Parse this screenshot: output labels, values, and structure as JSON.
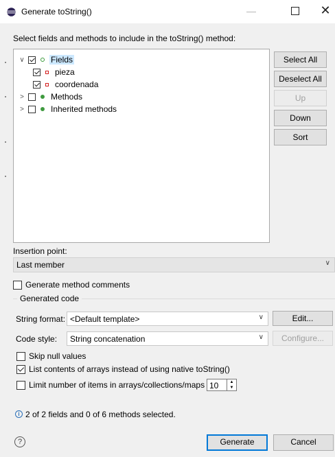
{
  "window": {
    "title": "Generate toString()",
    "minimize_glyph": "—",
    "close_glyph": "✕"
  },
  "instruction": "Select fields and methods to include in the toString() method:",
  "tree": {
    "twisty_expanded": "∨",
    "twisty_collapsed": ">",
    "items": [
      {
        "label": "Fields",
        "checked": true,
        "expanded": true,
        "icon": "field-group-hollow-green-circle"
      },
      {
        "label": "pieza",
        "checked": true,
        "icon": "private-field-red-square"
      },
      {
        "label": "coordenada",
        "checked": true,
        "icon": "private-field-red-square"
      },
      {
        "label": "Methods",
        "checked": false,
        "expanded": false,
        "icon": "method-green-dot"
      },
      {
        "label": "Inherited methods",
        "checked": false,
        "expanded": false,
        "icon": "method-green-dot"
      }
    ]
  },
  "side_buttons": {
    "select_all": "Select All",
    "deselect_all": "Deselect All",
    "up": "Up",
    "down": "Down",
    "sort": "Sort"
  },
  "insertion": {
    "label": "Insertion point:",
    "value": "Last member"
  },
  "generate_comments": {
    "label": "Generate method comments",
    "checked": false
  },
  "generated_code": {
    "legend": "Generated code",
    "string_format_label": "String format:",
    "string_format_value": "<Default template>",
    "edit_button": "Edit...",
    "code_style_label": "Code style:",
    "code_style_value": "String concatenation",
    "configure_button": "Configure...",
    "skip_null": {
      "label": "Skip null values",
      "checked": false
    },
    "list_contents": {
      "label": "List contents of arrays instead of using native toString()",
      "checked": true
    },
    "limit_items": {
      "label": "Limit number of items in arrays/collections/maps to",
      "checked": false,
      "value": "10"
    }
  },
  "status": {
    "icon_glyph": "i",
    "text": "2 of 2 fields and 0 of 6 methods selected."
  },
  "footer": {
    "help_glyph": "?",
    "generate_button": "Generate",
    "cancel_button": "Cancel"
  },
  "colors": {
    "accent": "#0078d7",
    "selection": "#cce8ff",
    "field_icon": "#d21e1e",
    "method_icon": "#3f9a3f"
  }
}
